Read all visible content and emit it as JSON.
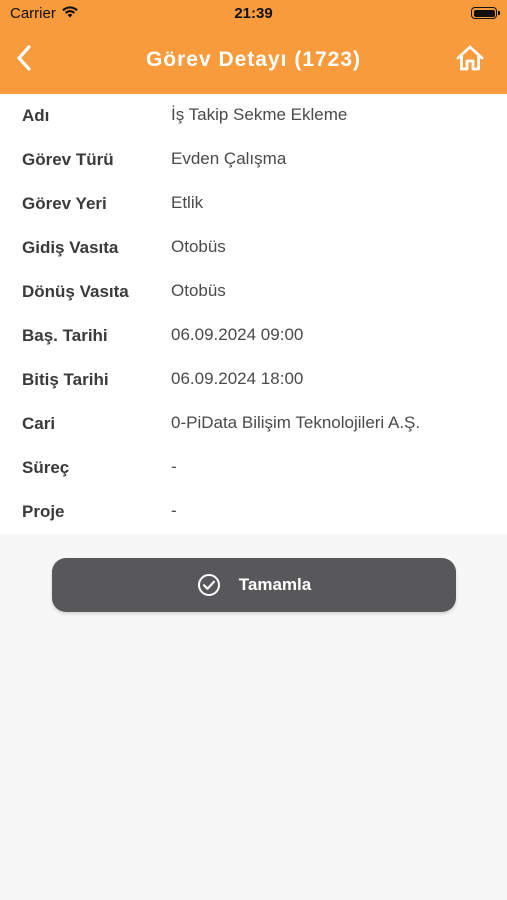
{
  "status_bar": {
    "carrier": "Carrier",
    "time": "21:39"
  },
  "nav": {
    "title": "Görev Detayı (1723)",
    "back_icon": "chevron-left-icon",
    "home_icon": "home-icon"
  },
  "details": [
    {
      "label": "Adı",
      "value": "İş Takip Sekme Ekleme"
    },
    {
      "label": "Görev Türü",
      "value": "Evden Çalışma"
    },
    {
      "label": "Görev Yeri",
      "value": "Etlik"
    },
    {
      "label": "Gidiş Vasıta",
      "value": "Otobüs"
    },
    {
      "label": "Dönüş Vasıta",
      "value": "Otobüs"
    },
    {
      "label": "Baş. Tarihi",
      "value": "06.09.2024 09:00"
    },
    {
      "label": "Bitiş Tarihi",
      "value": "06.09.2024 18:00"
    },
    {
      "label": "Cari",
      "value": "0-PiData Bilişim Teknolojileri A.Ş."
    },
    {
      "label": "Süreç",
      "value": "-"
    },
    {
      "label": "Proje",
      "value": "-"
    }
  ],
  "actions": {
    "complete_label": "Tamamla",
    "complete_icon": "check-circle-icon"
  },
  "colors": {
    "header": "#f79b3c",
    "button": "#58585b"
  }
}
